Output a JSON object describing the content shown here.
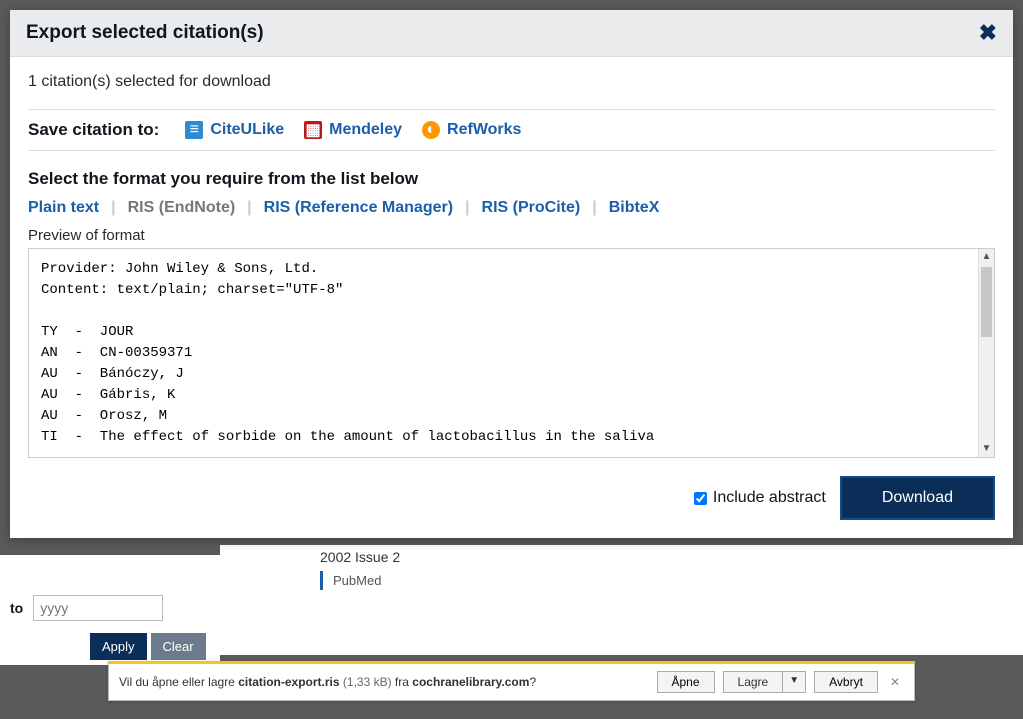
{
  "modal": {
    "title": "Export selected citation(s)",
    "count_line": "1 citation(s) selected for download",
    "save_label": "Save citation to:",
    "save_options": {
      "citeulike": "CiteULike",
      "mendeley": "Mendeley",
      "refworks": "RefWorks"
    },
    "format_header": "Select the format you require from the list below",
    "format_tabs": {
      "plain": "Plain text",
      "ris_endnote": "RIS (EndNote)",
      "ris_refman": "RIS (Reference Manager)",
      "ris_procite": "RIS (ProCite)",
      "bibtex": "BibteX"
    },
    "preview_label": "Preview of format",
    "preview_text": "Provider: John Wiley & Sons, Ltd.\nContent: text/plain; charset=\"UTF-8\"\n\nTY  -  JOUR\nAN  -  CN-00359371\nAU  -  Bánóczy, J\nAU  -  Gábris, K\nAU  -  Orosz, M\nTI  -  The effect of sorbide on the amount of lactobacillus in the saliva",
    "include_abstract_label": "Include abstract",
    "download_label": "Download"
  },
  "background": {
    "to_label": "to",
    "yyyy_placeholder": "yyyy",
    "apply_label": "Apply",
    "clear_label": "Clear",
    "issue_line": "2002 Issue 2",
    "pubmed_label": "PubMed"
  },
  "dlbar": {
    "prefix": "Vil du åpne eller lagre ",
    "filename": "citation-export.ris",
    "size": " (1,33 kB) ",
    "from": "fra ",
    "domain": "cochranelibrary.com",
    "suffix": "?",
    "open": "Åpne",
    "save": "Lagre",
    "cancel": "Avbryt"
  }
}
